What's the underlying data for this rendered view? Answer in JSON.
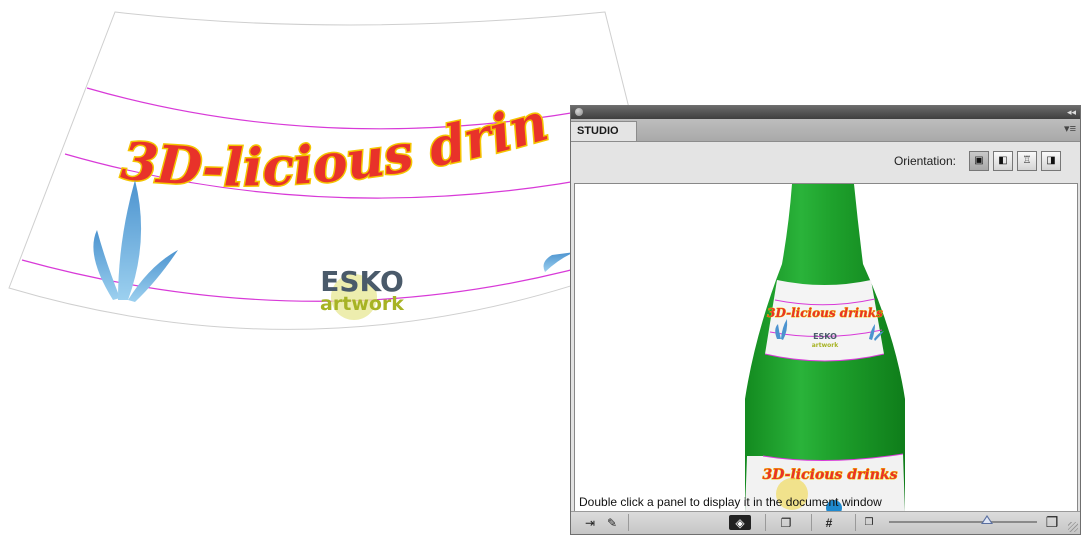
{
  "artwork": {
    "headline": "3D-licious drinks",
    "logo_brand": "ESKO",
    "logo_product": "artwork"
  },
  "panel": {
    "tab_label": "STUDIO",
    "orientation_label": "Orientation:",
    "orientation_buttons": [
      "front",
      "right",
      "top",
      "left"
    ],
    "hint_text": "Double click a panel to display it in the document window",
    "accent_colors": {
      "bottle": "#1e9e2a",
      "label_headline": "#e8322a",
      "label_outline": "#f4c400",
      "guide_lines": "#d83ad8",
      "splash": "#4d9bd1"
    }
  }
}
